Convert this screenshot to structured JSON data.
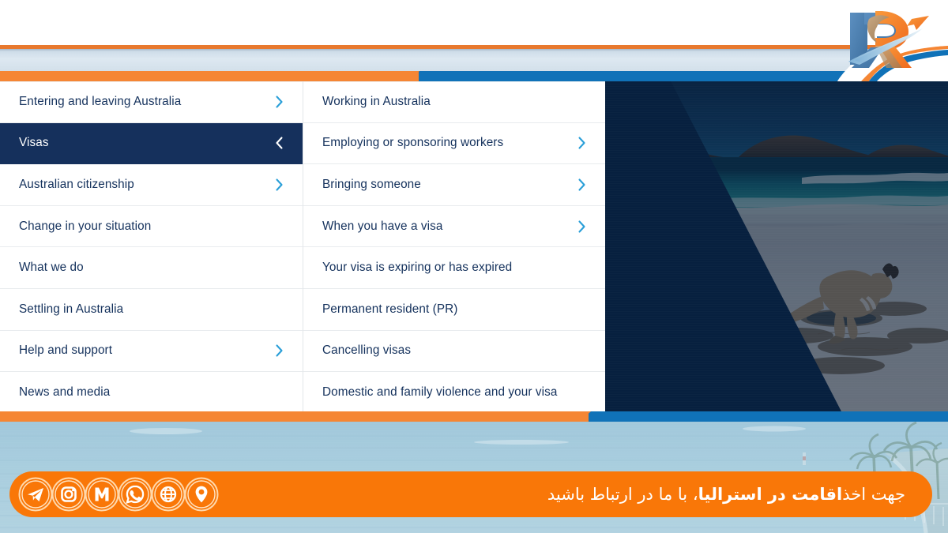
{
  "brand": {
    "logo_name": "r-arrow-logo",
    "colors": {
      "orange": "#f58634",
      "orange_bright": "#f97708",
      "blue": "#1072b8",
      "navy": "#15305c",
      "navy_dark": "#07203f",
      "chevron_blue": "#2a9fd8",
      "band_light": "#d3e0ea",
      "footer_water": "#a9cddd"
    }
  },
  "header": {
    "thin_rule_color": "#e8792e",
    "band_color": "#d3e0ea",
    "orange_bar_color": "#f58634",
    "blue_bar_color": "#1072b8"
  },
  "menu": {
    "column_primary": [
      {
        "label": "Entering and leaving Australia",
        "chevron": "chevron-right-icon",
        "active": false
      },
      {
        "label": "Visas",
        "chevron": "chevron-left-icon",
        "active": true
      },
      {
        "label": "Australian citizenship",
        "chevron": "chevron-right-icon",
        "active": false
      },
      {
        "label": "Change in your situation",
        "chevron": "",
        "active": false
      },
      {
        "label": "What we do",
        "chevron": "",
        "active": false
      },
      {
        "label": "Settling in Australia",
        "chevron": "",
        "active": false
      },
      {
        "label": "Help and support",
        "chevron": "chevron-right-icon",
        "active": false
      },
      {
        "label": "News and media",
        "chevron": "",
        "active": false
      }
    ],
    "column_secondary": [
      {
        "label": "Working in Australia",
        "chevron": "",
        "active": false
      },
      {
        "label": "Employing or sponsoring workers",
        "chevron": "chevron-right-icon",
        "active": false
      },
      {
        "label": "Bringing someone",
        "chevron": "chevron-right-icon",
        "active": false
      },
      {
        "label": "When you have a visa",
        "chevron": "chevron-right-icon",
        "active": false
      },
      {
        "label": "Your visa is expiring or has expired",
        "chevron": "",
        "active": false
      },
      {
        "label": "Permanent resident (PR)",
        "chevron": "",
        "active": false
      },
      {
        "label": "Cancelling visas",
        "chevron": "",
        "active": false
      },
      {
        "label": "Domestic and family violence and your visa",
        "chevron": "",
        "active": false
      }
    ]
  },
  "hero": {
    "image_name": "kangaroo-on-beach-photo",
    "overlay_name": "navy-diagonal-wedge"
  },
  "footer": {
    "background_image_name": "waterfront-palms-photo",
    "ribbon_text_parts": [
      {
        "text": "جهت اخذ ",
        "bold": false
      },
      {
        "text": "اقامت در استرالیا",
        "bold": true
      },
      {
        "text": "، با ما در ارتباط باشید",
        "bold": false
      }
    ],
    "ribbon_text_full": "جهت اخذ اقامت در استرالیا، با ما در ارتباط باشید",
    "social_icons": [
      {
        "name": "telegram-icon",
        "label": "Telegram"
      },
      {
        "name": "instagram-icon",
        "label": "Instagram"
      },
      {
        "name": "mail-m-icon",
        "label": "M"
      },
      {
        "name": "whatsapp-icon",
        "label": "WhatsApp"
      },
      {
        "name": "globe-icon",
        "label": "Website"
      },
      {
        "name": "location-pin-icon",
        "label": "Location"
      }
    ]
  }
}
